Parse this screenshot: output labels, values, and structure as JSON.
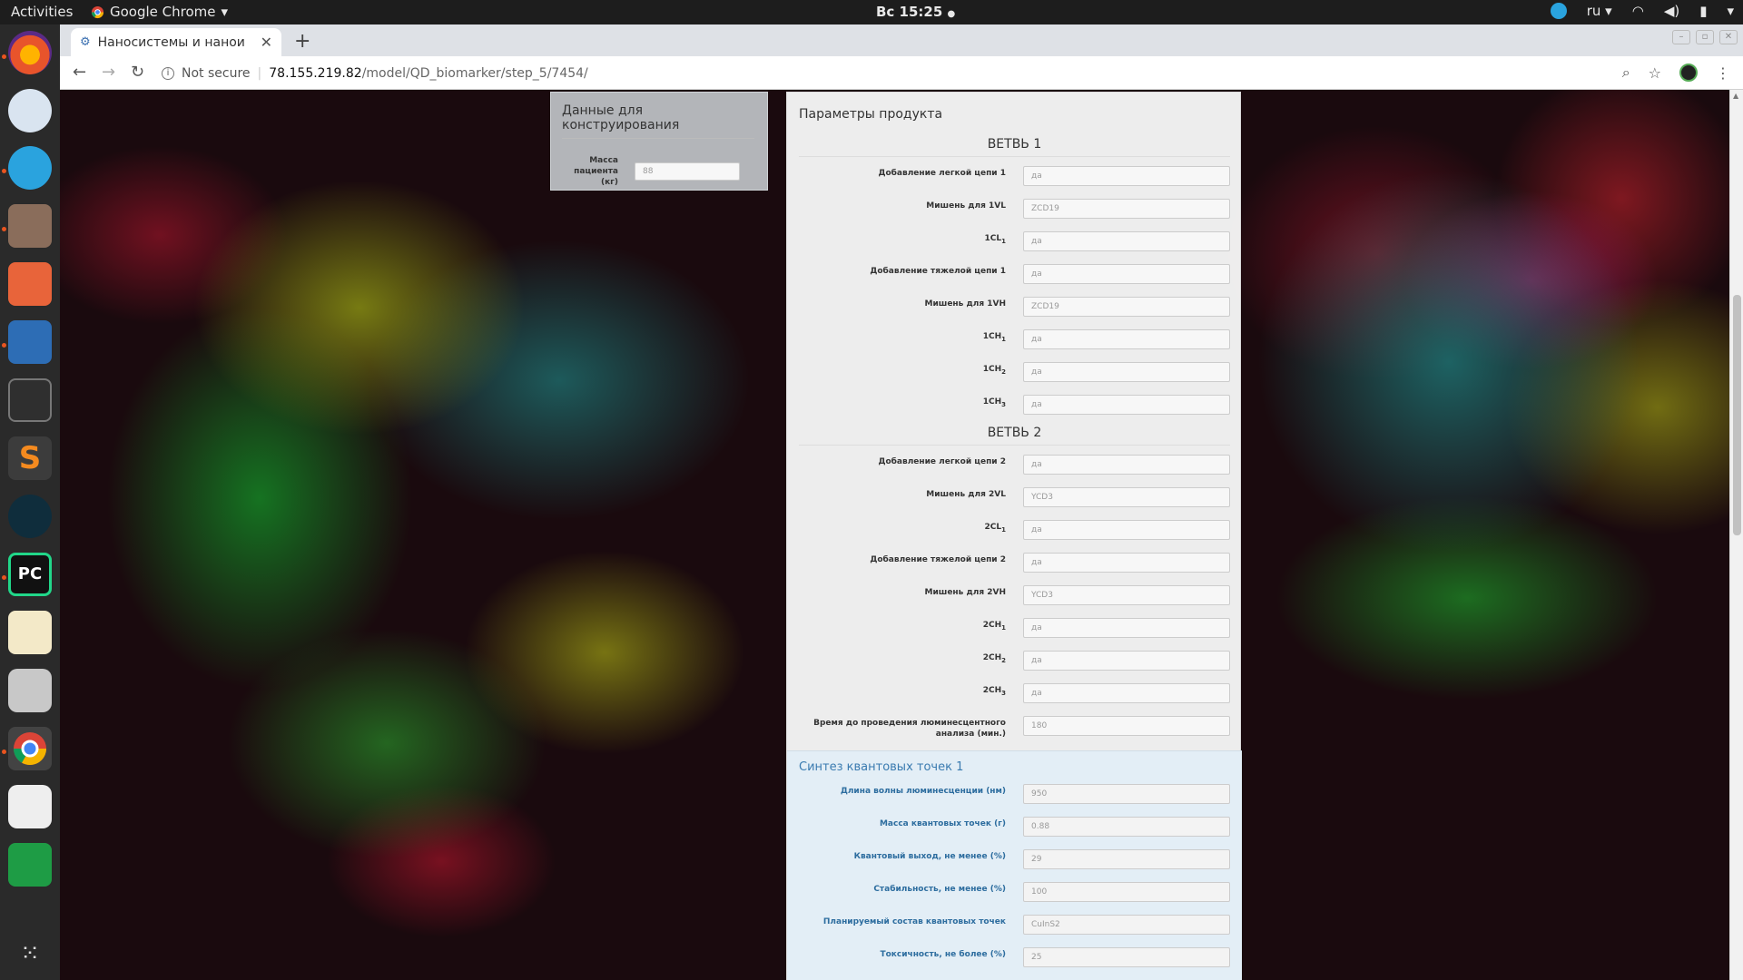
{
  "topbar": {
    "activities": "Activities",
    "app_name": "Google Chrome",
    "clock": "Вс 15:25",
    "keyboard_layout": "ru"
  },
  "browser": {
    "tab_title": "Наносистемы и нанои",
    "url_security": "Not secure",
    "url_host": "78.155.219.82",
    "url_path": "/model/QD_biomarker/step_5/7454/"
  },
  "left_panel": {
    "title": "Данные для конструирования",
    "mass_label": "Масса пациента (кг)",
    "mass_value": "88"
  },
  "right_panel": {
    "title": "Параметры продукта",
    "branch1": {
      "title": "ВЕТВЬ 1",
      "fields": [
        {
          "label": "Добавление легкой цепи 1",
          "value": "да"
        },
        {
          "label": "Мишень для 1VL",
          "value": "ZCD19"
        },
        {
          "label": "1CL",
          "sub": "1",
          "value": "да"
        },
        {
          "label": "Добавление тяжелой цепи 1",
          "value": "да"
        },
        {
          "label": "Мишень для 1VH",
          "value": "ZCD19"
        },
        {
          "label": "1CH",
          "sub": "1",
          "value": "да"
        },
        {
          "label": "1CH",
          "sub": "2",
          "value": "да"
        },
        {
          "label": "1CH",
          "sub": "3",
          "value": "да"
        }
      ]
    },
    "branch2": {
      "title": "ВЕТВЬ 2",
      "fields": [
        {
          "label": "Добавление легкой цепи 2",
          "value": "да"
        },
        {
          "label": "Мишень для 2VL",
          "value": "YCD3"
        },
        {
          "label": "2CL",
          "sub": "1",
          "value": "да"
        },
        {
          "label": "Добавление тяжелой цепи 2",
          "value": "да"
        },
        {
          "label": "Мишень для 2VH",
          "value": "YCD3"
        },
        {
          "label": "2CH",
          "sub": "1",
          "value": "да"
        },
        {
          "label": "2CH",
          "sub": "2",
          "value": "да"
        },
        {
          "label": "2CH",
          "sub": "3",
          "value": "да"
        },
        {
          "label": "Время до проведения люминесцентного анализа (мин.)",
          "value": "180"
        }
      ]
    },
    "quantum": {
      "title": "Синтез квантовых точек 1",
      "fields": [
        {
          "label": "Длина волны люминесценции (нм)",
          "value": "950"
        },
        {
          "label": "Масса квантовых точек (г)",
          "value": "0.88"
        },
        {
          "label": "Квантовый выход, не менее (%)",
          "value": "29"
        },
        {
          "label": "Стабильность, не менее (%)",
          "value": "100"
        },
        {
          "label": "Планируемый состав квантовых точек",
          "value": "CuInS2"
        },
        {
          "label": "Токсичность, не более (%)",
          "value": "25"
        }
      ]
    }
  }
}
